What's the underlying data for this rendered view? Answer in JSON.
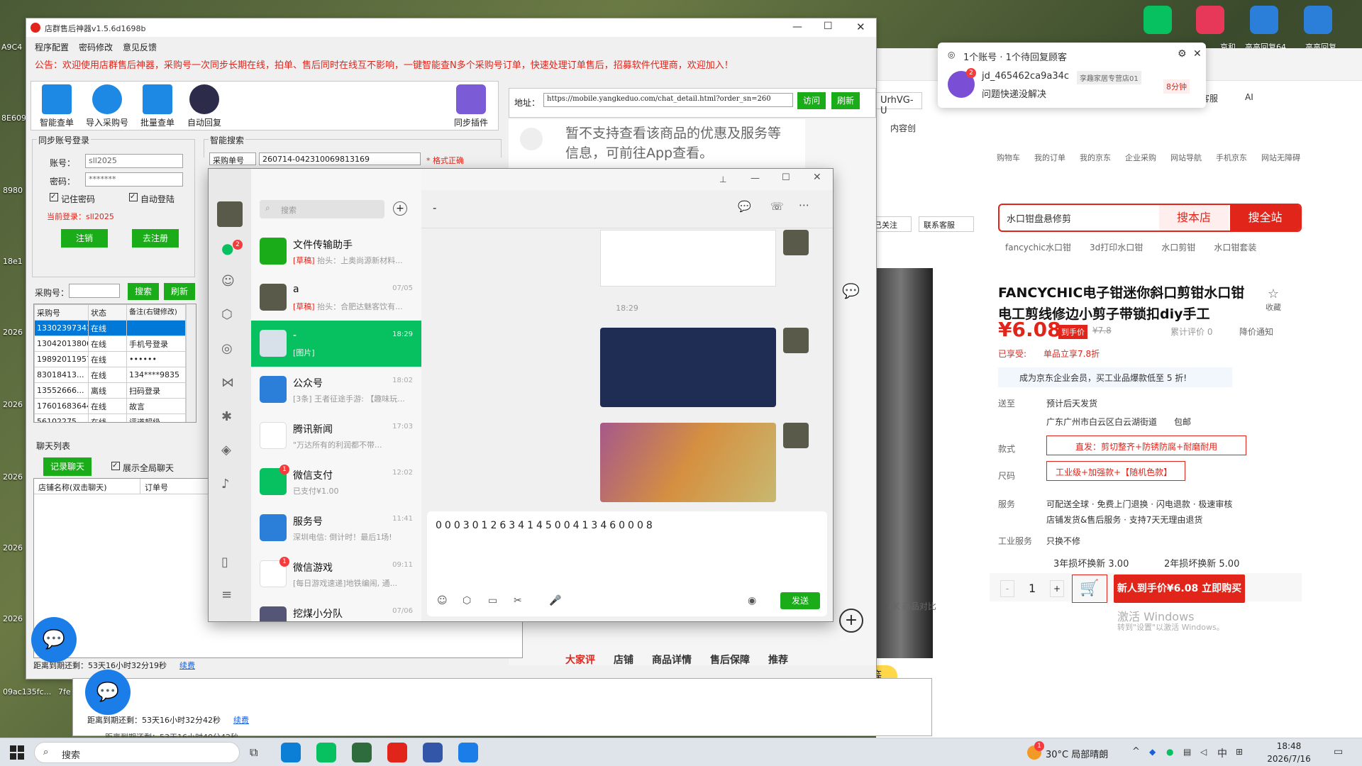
{
  "desktop": {
    "labels": [
      "A9C4",
      "8E609",
      "8980",
      "18e1",
      "2026",
      "2026",
      "2026",
      "2026",
      "2026",
      "09ac135fc...",
      "7fe"
    ],
    "top_right_labels": [
      "哀和",
      "高高回复64",
      "高高回复"
    ]
  },
  "tool": {
    "title": "店群售后神器v1.5.6d1698b",
    "menu": [
      "程序配置",
      "密码修改",
      "意见反馈"
    ],
    "notice": "公告：欢迎使用店群售后神器，采购号一次同步长期在线，拍单、售后同时在线互不影响，一键智能查N多个采购号订单，快速处理订单售后，招募软件代理商，欢迎加入！",
    "toolbar": [
      "智能查单",
      "导入采购号",
      "批量查单",
      "自动回复"
    ],
    "plugin": "同步插件",
    "url_label": "地址：",
    "url": "https://mobile.yangkeduo.com/chat_detail.html?order_sn=260",
    "visit": "访问",
    "refresh": "刷新",
    "login": {
      "group": "同步账号登录",
      "account_label": "账号：",
      "account": "sll2025",
      "password_label": "密码：",
      "password": "*******",
      "remember": "记住密码",
      "autologin": "自动登陆",
      "current": "当前登录：sll2025",
      "logout": "注销",
      "register": "去注册"
    },
    "smart": {
      "group": "智能搜索",
      "select": "采购单号",
      "value": "260714-042310069813169",
      "status": "* 格式正确"
    },
    "buyer": {
      "label": "采购号：",
      "search": "搜索",
      "refresh": "刷新",
      "cols": [
        "采购号",
        "状态",
        "备注(右键修改)"
      ],
      "rows": [
        [
          "13302397341",
          "在线",
          ""
        ],
        [
          "13042013806",
          "在线",
          "手机号登录"
        ],
        [
          "19892011957",
          "在线",
          "••••••"
        ],
        [
          "83018413...",
          "在线",
          "134****9835"
        ],
        [
          "13552666...",
          "离线",
          "扫码登录"
        ],
        [
          "17601683644",
          "在线",
          "故言"
        ],
        [
          "56102275...",
          "在线",
          "评道超级"
        ]
      ]
    },
    "chatlist": {
      "group": "聊天列表",
      "record": "记录聊天",
      "showall": "展示全局聊天",
      "cols": [
        "店铺名称(双击聊天)",
        "订单号"
      ]
    },
    "expire": "距离到期还剩：53天16小时32分19秒",
    "renew": "续费",
    "pdd_text": "暂不支持查看该商品的优惠及服务等信息，可前往App查看。",
    "pdd_tabs": [
      "大家评",
      "店铺",
      "商品详情",
      "售后保障",
      "推荐"
    ]
  },
  "tool2": {
    "expire": "距离到期还剩：53天16小时32分42秒",
    "renew": "续费",
    "expire3": "距离到期还剩：53天16小时40分42秒"
  },
  "wechat": {
    "search_placeholder": "搜索",
    "chat_title": "-",
    "badge_chat": "2",
    "chats": [
      {
        "name": "文件传输助手",
        "draft": "[草稿]",
        "preview": "抬头：上奥尚源新材料...",
        "time": ""
      },
      {
        "name": "a",
        "draft": "[草稿]",
        "preview": "抬头：合肥达魅客饮有...",
        "time": "07/05"
      },
      {
        "name": "-",
        "draft": "",
        "preview": "[图片]",
        "time": "18:29"
      },
      {
        "name": "公众号",
        "draft": "",
        "preview": "[3条] 王者征途手游: 【趣味玩...",
        "time": "18:02"
      },
      {
        "name": "腾讯新闻",
        "draft": "",
        "preview": "\"万达所有的利润都不带...",
        "time": "17:03"
      },
      {
        "name": "微信支付",
        "draft": "",
        "preview": "已支付¥1.00",
        "time": "12:02",
        "badge": "1"
      },
      {
        "name": "服务号",
        "draft": "",
        "preview": "深圳电信: 倒计时！最后1场!",
        "time": "11:41"
      },
      {
        "name": "微信游戏",
        "draft": "",
        "preview": "[每日游戏速递]地铁编闹, 通...",
        "time": "09:11",
        "badge": "1"
      },
      {
        "name": "挖煤小分队",
        "draft": "",
        "preview": "",
        "time": "07/06"
      }
    ],
    "time_marker": "18:29",
    "input_text": "000301263414500413460008",
    "send": "发送"
  },
  "browser": {
    "tab": "UrhVG-U",
    "tab2": "内容创",
    "nav": [
      "购物车",
      "我的订单",
      "我的京东",
      "企业采购",
      "网站导航",
      "手机京东",
      "网站无障碍"
    ],
    "top_icons": [
      "咚咚",
      "客服",
      "AI"
    ],
    "search_value": "水口钳盘悬修剪",
    "search_this": "搜本店",
    "search_all": "搜全站",
    "hot": [
      "fancychic水口钳",
      "3d打印水口钳",
      "水口剪钳",
      "水口钳套装"
    ],
    "follow": "已关注",
    "contact": "联系客服",
    "product_title": "FANCYCHIC电子钳迷你斜口剪钳水口钳电工剪线修边小剪子带锁扣diy手工",
    "collect": "收藏",
    "price": "¥6.08",
    "price_tag": "到手价",
    "orig_price": "¥7.8",
    "reviews": "累计评价 0",
    "price_notice": "降价通知",
    "enjoy_label": "已享受:",
    "enjoy": "单品立享7.8折",
    "enterprise": "成为京东企业会员，买工业品爆款低至 5 折!",
    "ship_label": "送至",
    "ship": "预计后天发货",
    "address": "广东广州市白云区白云湖街道",
    "free": "包邮",
    "style_label": "款式",
    "style": "直发：剪切整齐+防锈防腐+耐磨耐用",
    "size_label": "尺码",
    "size": "工业级+加强款+【随机色款】",
    "service_label": "服务",
    "service1": "可配送全球 · 免费上门退换 · 闪电退款 · 极速审核",
    "service2": "店铺发货&售后服务 · 支持7天无理由退货",
    "industrial_label": "工业服务",
    "industrial": "只换不修",
    "warranty1": "3年损坏换新 3.00",
    "warranty2": "2年损坏换新 5.00",
    "qty": "1",
    "buy": "新人到手价¥6.08 立即购买",
    "pk": "PK 商品对比",
    "activate1": "激活 Windows",
    "activate2": "转到\"设置\"以激活 Windows。",
    "yellow_tag": "等"
  },
  "notify": {
    "title": "1个账号 · 1个待回复顾客",
    "user": "jd_465462ca9a34c",
    "shop": "孪趣家居专营店01",
    "time": "8分钟",
    "msg": "问题快递没解决",
    "badge": "2"
  },
  "taskbar": {
    "search": "搜索",
    "weather": "30°C 局部晴朗",
    "lang": "中",
    "time": "18:48",
    "date": "2026/7/16",
    "weather_badge": "1"
  }
}
